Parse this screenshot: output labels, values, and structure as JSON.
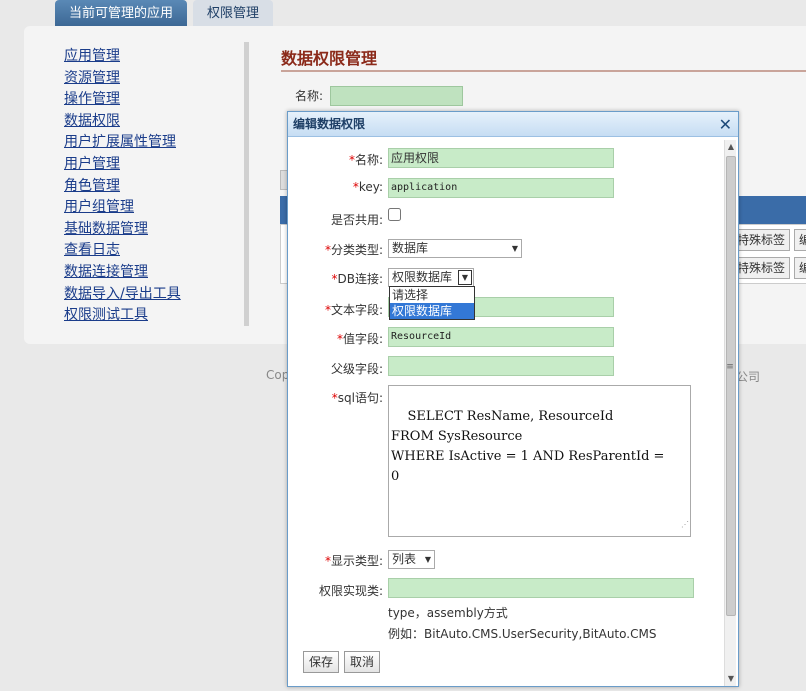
{
  "tabs": [
    {
      "label": "当前可管理的应用"
    },
    {
      "label": "权限管理"
    }
  ],
  "sidebar": {
    "items": [
      {
        "label": "应用管理"
      },
      {
        "label": "资源管理"
      },
      {
        "label": "操作管理"
      },
      {
        "label": "数据权限"
      },
      {
        "label": "用户扩展属性管理"
      },
      {
        "label": "用户管理"
      },
      {
        "label": "角色管理"
      },
      {
        "label": "用户组管理"
      },
      {
        "label": "基础数据管理"
      },
      {
        "label": "查看日志"
      },
      {
        "label": "数据连接管理"
      },
      {
        "label": "数据导入/导出工具"
      },
      {
        "label": "权限测试工具"
      }
    ]
  },
  "content": {
    "title": "数据权限管理",
    "name_label": "名称:",
    "grid_button_1": "特殊标签",
    "grid_button_2": "编",
    "copyright": "Cop",
    "company": "公司"
  },
  "dialog": {
    "title": "编辑数据权限",
    "close": "✕",
    "fields": {
      "name": {
        "label": "名称:",
        "value": "应用权限"
      },
      "key": {
        "label": "key:",
        "value": "application"
      },
      "shared": {
        "label": "是否共用:",
        "checked": false
      },
      "category": {
        "label": "分类类型:",
        "value": "数据库"
      },
      "db": {
        "label": "DB连接:",
        "value": "权限数据库",
        "options": [
          "请选择",
          "权限数据库"
        ]
      },
      "text_field": {
        "label": "文本字段:",
        "value": ""
      },
      "value_field": {
        "label": "值字段:",
        "value": "ResourceId"
      },
      "parent_field": {
        "label": "父级字段:",
        "value": ""
      },
      "sql": {
        "label": "sql语句:",
        "value": "SELECT ResName, ResourceId\nFROM SysResource\nWHERE IsActive = 1 AND ResParentId =\n0"
      },
      "display": {
        "label": "显示类型:",
        "value": "列表"
      },
      "impl": {
        "label": "权限实现类:",
        "value": ""
      }
    },
    "hint1": "type，assembly方式",
    "hint2": "例如：BitAuto.CMS.UserSecurity,BitAuto.CMS",
    "save_label": "保存",
    "cancel_label": "取消",
    "required_mark": "*"
  }
}
